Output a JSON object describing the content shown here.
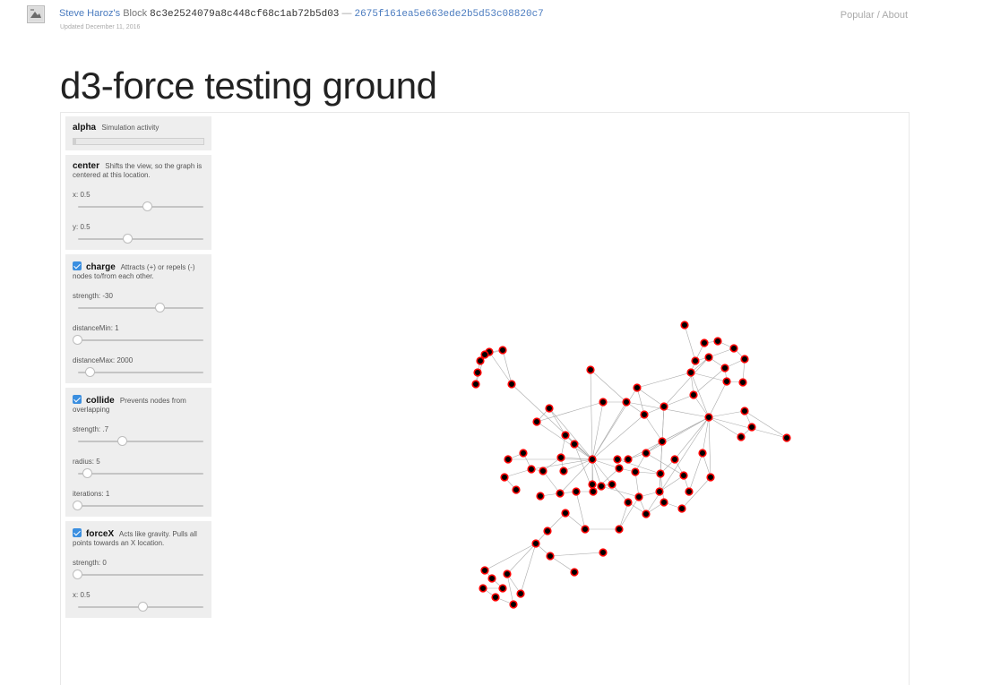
{
  "header": {
    "author_link": "Steve Haroz's",
    "block_label": "Block",
    "block_id": "8c3e2524079a8c448cf68c1ab72b5d03",
    "separator": "—",
    "commit_hash": "2675f161ea5e663ede2b5d53c08820c7",
    "updated": "Updated December 11, 2016",
    "nav_popular": "Popular",
    "nav_sep": " / ",
    "nav_about": "About"
  },
  "page_title": "d3-force testing ground",
  "panels": {
    "alpha": {
      "name": "alpha",
      "desc": "Simulation activity",
      "fill": 0.02
    },
    "center": {
      "name": "center",
      "desc": "Shifts the view, so the graph is centered at this location.",
      "sliders": [
        {
          "label": "x: 0.5",
          "value": 0.56
        },
        {
          "label": "y: 0.5",
          "value": 0.4
        }
      ]
    },
    "charge": {
      "name": "charge",
      "checked": true,
      "desc": "Attracts (+) or repels (-) nodes to/from each other.",
      "sliders": [
        {
          "label": "strength: -30",
          "value": 0.66
        },
        {
          "label": "distanceMin: 1",
          "value": 0.0
        },
        {
          "label": "distanceMax: 2000",
          "value": 0.1
        }
      ]
    },
    "collide": {
      "name": "collide",
      "checked": true,
      "desc": "Prevents nodes from overlapping",
      "sliders": [
        {
          "label": "strength: .7",
          "value": 0.36
        },
        {
          "label": "radius: 5",
          "value": 0.08
        },
        {
          "label": "iterations: 1",
          "value": 0.0
        }
      ]
    },
    "forceX": {
      "name": "forceX",
      "checked": true,
      "desc": "Acts like gravity. Pulls all points towards an X location.",
      "sliders": [
        {
          "label": "strength: 0",
          "value": 0.0
        },
        {
          "label": "x: 0.5",
          "value": 0.52
        }
      ]
    }
  }
}
